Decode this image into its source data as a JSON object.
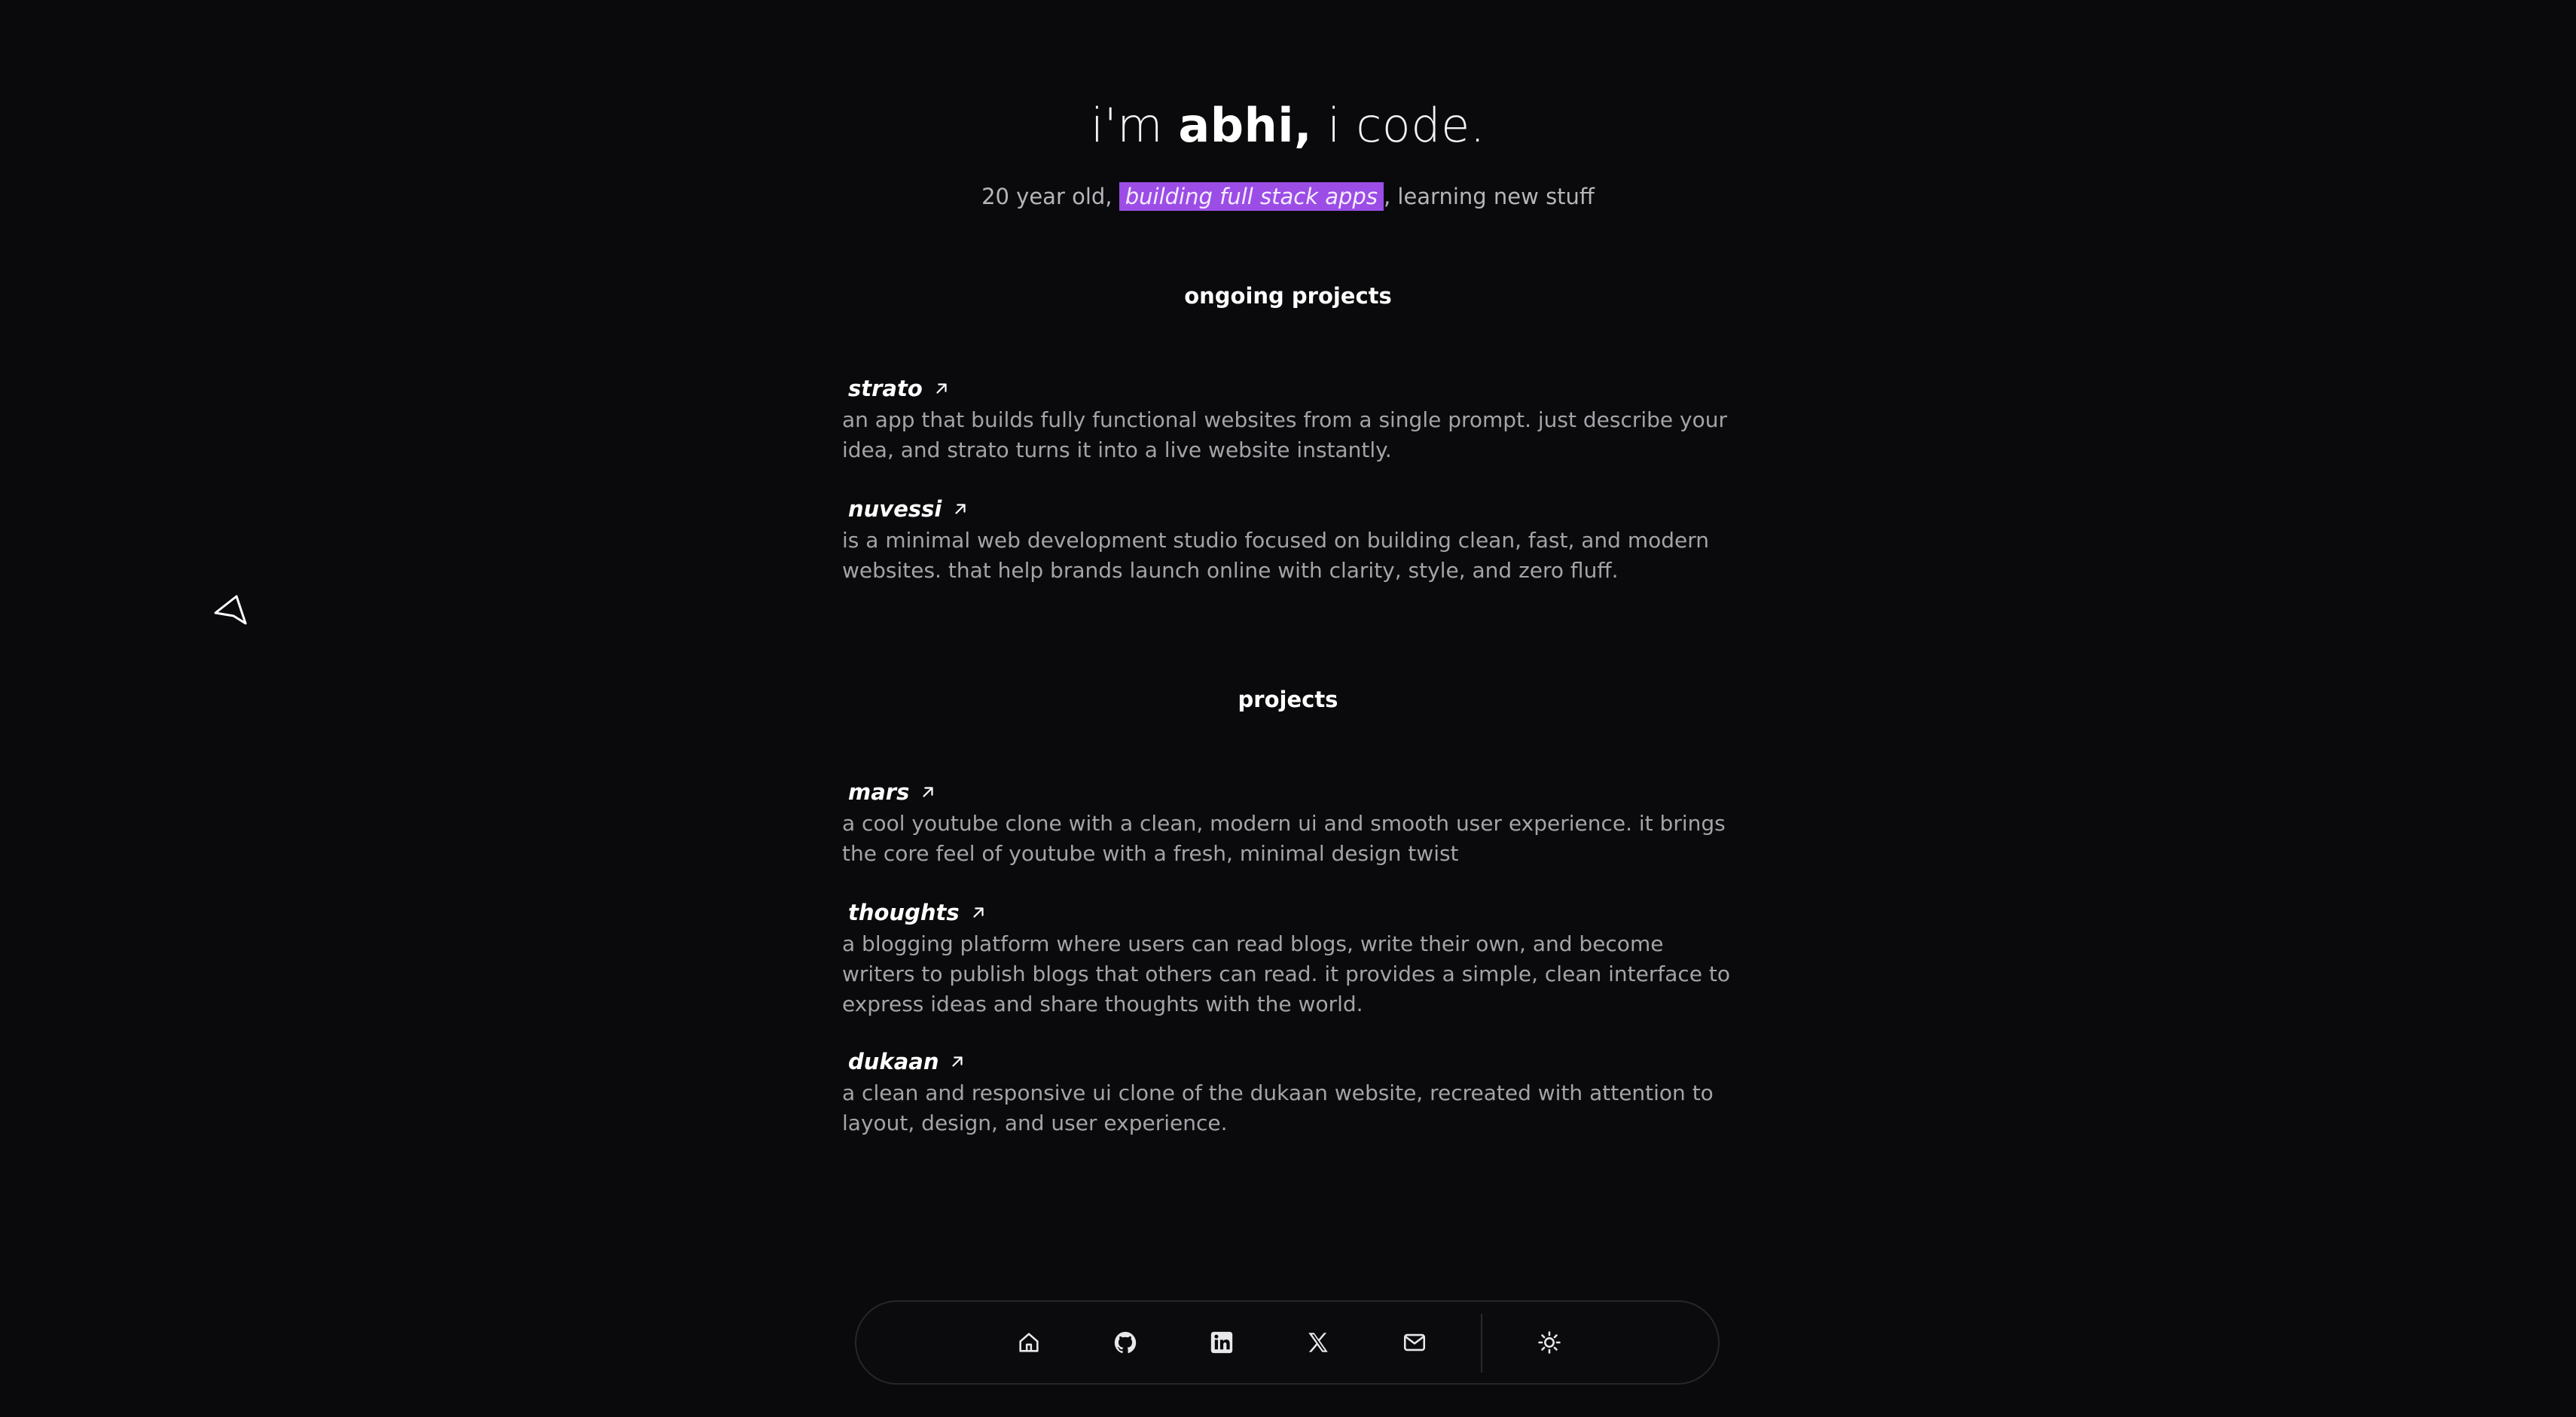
{
  "hero": {
    "prefix": "i'm ",
    "name": "abhi,",
    "suffix": " i code.",
    "sub_before": "20 year old, ",
    "sub_highlight": "building full stack apps",
    "sub_after": ", learning new stuff"
  },
  "ongoing": {
    "title": "ongoing projects",
    "items": [
      {
        "name": "strato",
        "description": "an app that builds fully functional websites from a single prompt. just describe your idea, and strato turns it into a live website instantly."
      },
      {
        "name": "nuvessi",
        "description": "is a minimal web development studio focused on building clean, fast, and modern websites. that help brands launch online with clarity, style, and zero fluff."
      }
    ]
  },
  "projects": {
    "title": "projects",
    "items": [
      {
        "name": "mars",
        "description": "a cool youtube clone with a clean, modern ui and smooth user experience. it brings the core feel of youtube with a fresh, minimal design twist"
      },
      {
        "name": "thoughts",
        "description": "a blogging platform where users can read blogs, write their own, and become writers to publish blogs that others can read. it provides a simple, clean interface to express ideas and share thoughts with the world."
      },
      {
        "name": "dukaan",
        "description": "a clean and responsive ui clone of the dukaan website, recreated with attention to layout, design, and user experience."
      }
    ]
  },
  "dock": {
    "icons": [
      "home-icon",
      "github-icon",
      "linkedin-icon",
      "x-icon",
      "mail-icon",
      "sun-icon"
    ]
  },
  "colors": {
    "background": "#0a0a0c",
    "highlight": "#9b4de6",
    "text": "#ffffff",
    "muted": "#a3a3a8"
  }
}
